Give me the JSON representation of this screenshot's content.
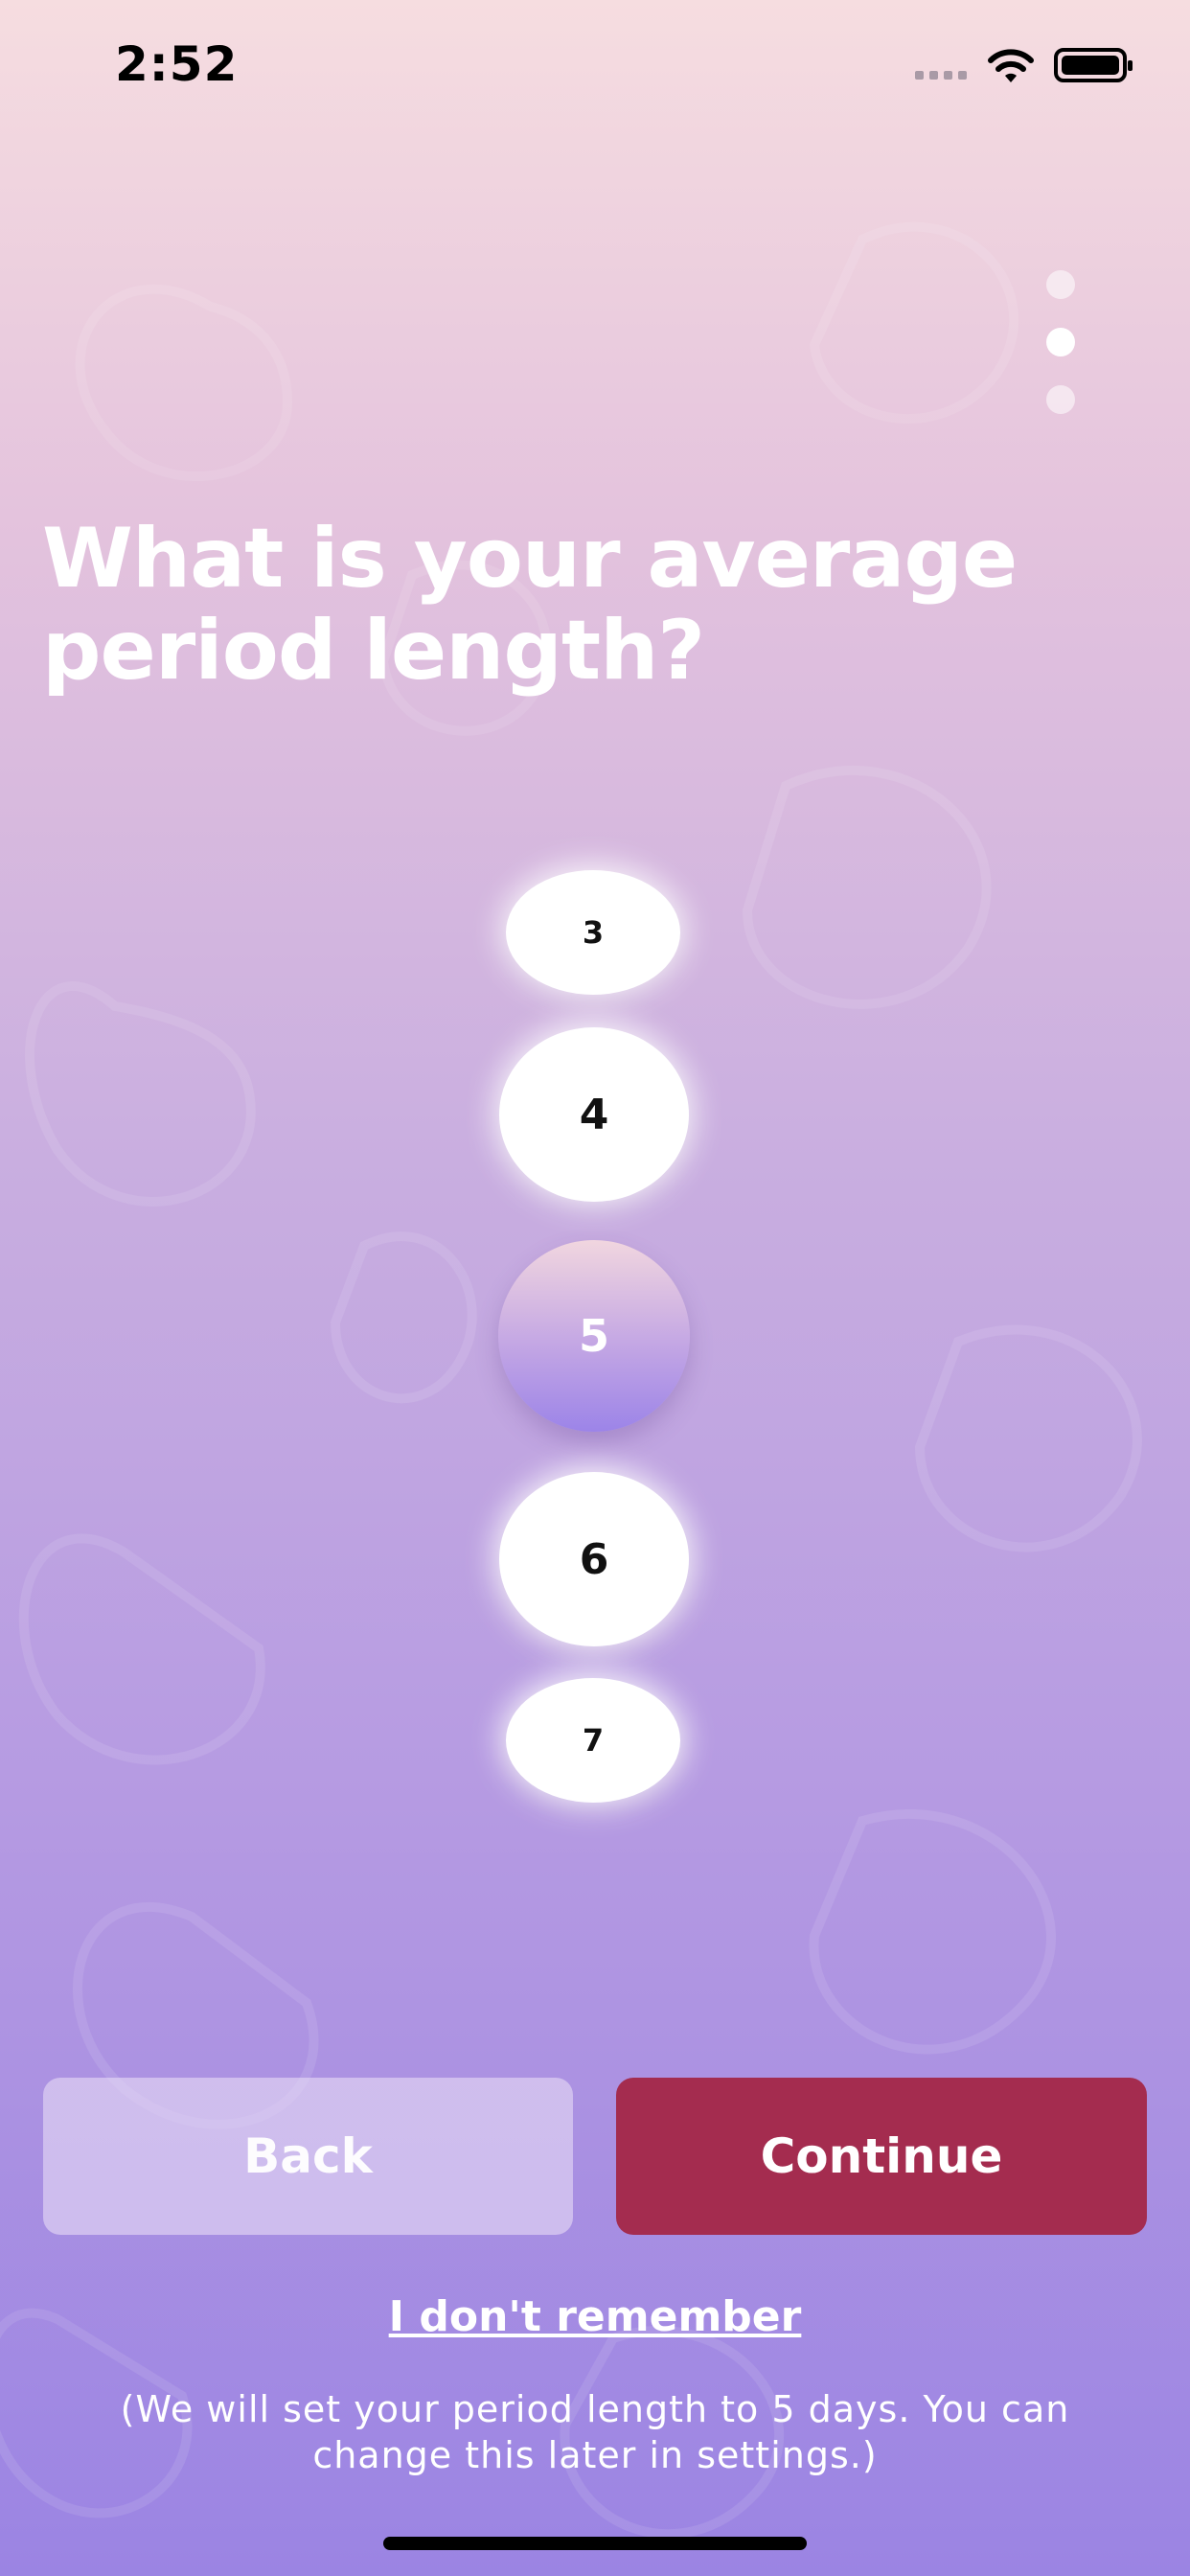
{
  "status_bar": {
    "time": "2:52",
    "wifi_icon": "wifi-icon",
    "battery_icon": "battery-icon",
    "signal_icon": "cellular-signal-icon"
  },
  "pager": {
    "total": 3,
    "active_index": 1
  },
  "question": {
    "line1": "What is your average",
    "line2": "period length?"
  },
  "picker": {
    "options": [
      "3",
      "4",
      "5",
      "6",
      "7"
    ],
    "selected": "5"
  },
  "buttons": {
    "back": "Back",
    "continue": "Continue"
  },
  "dont_remember": "I don't remember",
  "note": "(We will set your period length to 5 days. You can change this later in settings.)",
  "colors": {
    "continue_button": "#a42c4f",
    "background_top": "#f6dde0",
    "background_bottom": "#9b84e3"
  }
}
